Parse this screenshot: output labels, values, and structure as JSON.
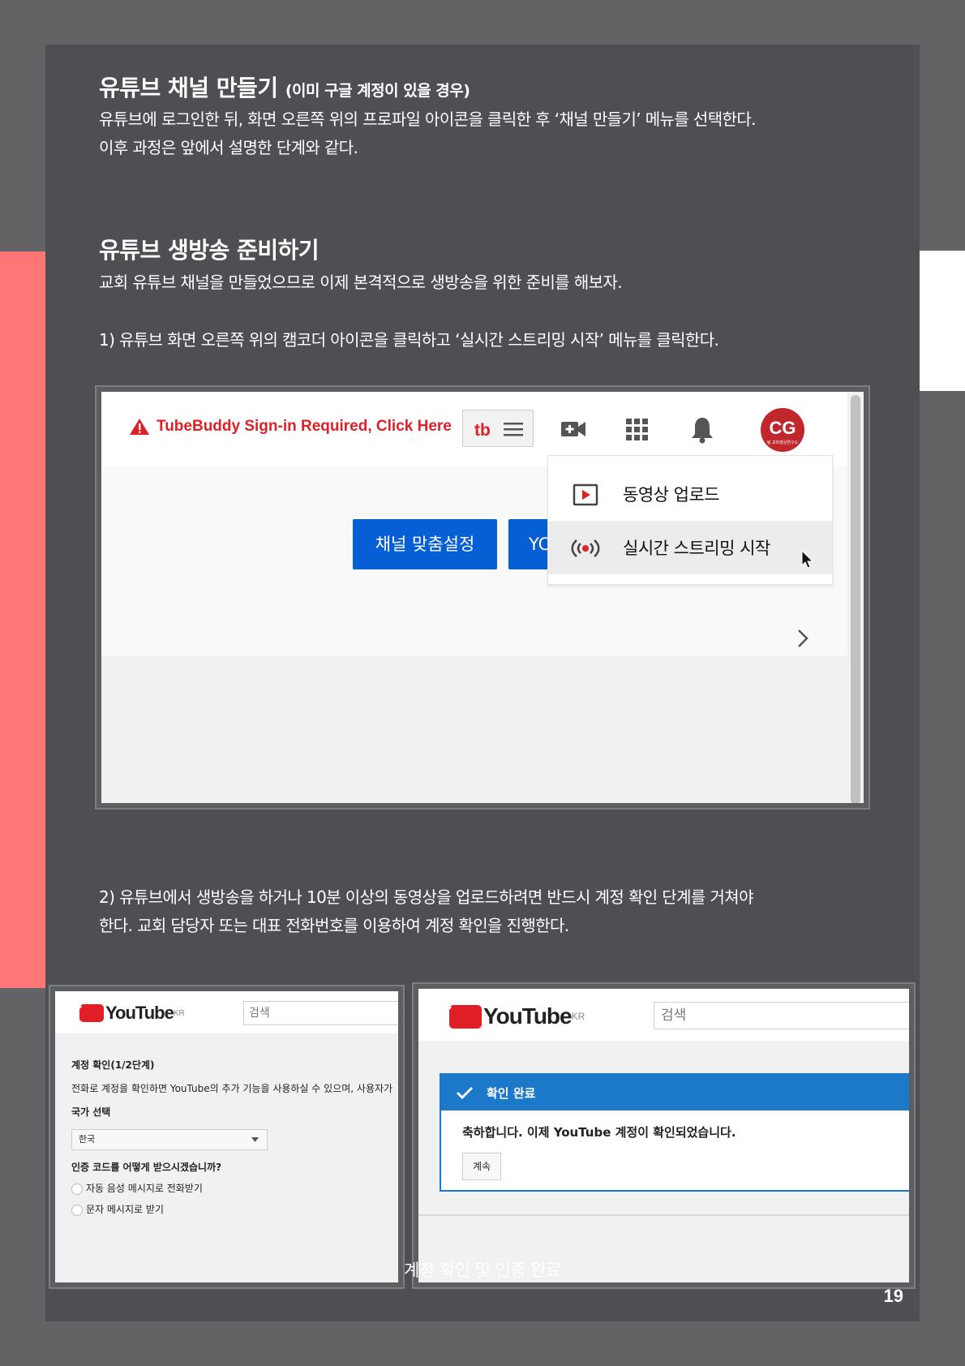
{
  "section1": {
    "title": "유튜브 채널 만들기",
    "title_sub": "(이미 구글 계정이 있을 경우)",
    "line1": "유튜브에 로그인한 뒤, 화면 오른쪽 위의 프로파일 아이콘을 클릭한 후 ‘채널 만들기’ 메뉴를 선택한다.",
    "line2": "이후 과정은 앞에서 설명한 단계와 같다."
  },
  "section2": {
    "title": "유튜브 생방송 준비하기",
    "intro": "교회 유튜브 채널을 만들었으므로 이제 본격적으로 생방송을 위한 준비를 해보자.",
    "step1": "1) 유튜브 화면 오른쪽 위의 캠코더 아이콘을 클릭하고 ‘실시간 스트리밍 시작’ 메뉴를 클릭한다.",
    "step2_line1": "2) 유튜브에서 생방송을 하거나 10분 이상의 동영상을 업로드하려면 반드시 계정 확인 단계를 거쳐야",
    "step2_line2": "한다. 교회 담당자 또는 대표 전화번호를 이용하여 계정 확인을 진행한다."
  },
  "screenshot1": {
    "tubebuddy_warning": "TubeBuddy Sign-in Required, Click Here",
    "avatar_initials": "CG",
    "avatar_subtext": "팀 교회영상연구소",
    "customize_channel_button": "채널 맞춤설정",
    "second_button_partial": "YC",
    "menu_upload": "동영상 업로드",
    "menu_live": "실시간 스트리밍 시작"
  },
  "screenshot2": {
    "logo_text": "YouTube",
    "logo_region": "KR",
    "search_placeholder": "검색",
    "step_title": "계정 확인(1/2단계)",
    "description": "전화로 계정을 확인하면 YouTube의 추가 기능을 사용하실 수 있으며, 사용자가",
    "country_label": "국가 선택",
    "country_value": "한국",
    "method_question": "인증 코드를 어떻게 받으시겠습니까?",
    "option_voice": "자동 음성 메시지로 전화받기",
    "option_sms": "문자 메시지로 받기"
  },
  "screenshot3": {
    "logo_text": "YouTube",
    "logo_region": "KR",
    "search_placeholder": "검색",
    "banner_title": "확인 완료",
    "message": "축하합니다. 이제 YouTube 계정이 확인되었습니다.",
    "continue_button": "계속"
  },
  "caption": "계정 확인 및 인증 완료",
  "page_number": "19",
  "colors": {
    "page_bg": "#4e4f53",
    "outer_bg": "#636365",
    "accent_red": "#ff7676",
    "youtube_red": "#e01f26",
    "youtube_blue": "#065fd4",
    "banner_blue": "#1c78c8"
  }
}
